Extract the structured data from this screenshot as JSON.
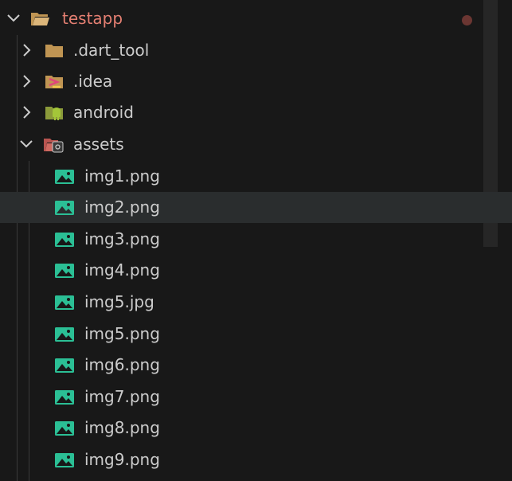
{
  "explorer": {
    "root": {
      "label": "testapp",
      "icon": "folder-open-icon",
      "expanded": true,
      "modified_dot_color": "#6b3632"
    },
    "folders": [
      {
        "label": ".dart_tool",
        "icon": "folder-icon",
        "expanded": false
      },
      {
        "label": ".idea",
        "icon": "idea-folder-icon",
        "expanded": false
      },
      {
        "label": "android",
        "icon": "android-folder-icon",
        "expanded": false
      },
      {
        "label": "assets",
        "icon": "assets-folder-icon",
        "expanded": true
      }
    ],
    "files": [
      {
        "label": "img1.png",
        "icon": "image-icon"
      },
      {
        "label": "img2.png",
        "icon": "image-icon",
        "selected": true
      },
      {
        "label": "img3.png",
        "icon": "image-icon"
      },
      {
        "label": "img4.png",
        "icon": "image-icon"
      },
      {
        "label": "img5.jpg",
        "icon": "image-icon"
      },
      {
        "label": "img5.png",
        "icon": "image-icon"
      },
      {
        "label": "img6.png",
        "icon": "image-icon"
      },
      {
        "label": "img7.png",
        "icon": "image-icon"
      },
      {
        "label": "img8.png",
        "icon": "image-icon"
      },
      {
        "label": "img9.png",
        "icon": "image-icon"
      }
    ],
    "colors": {
      "background": "#181818",
      "selected_row": "#2a2d2e",
      "root_label": "#e47f72",
      "text": "#cccccc",
      "image_icon": "#2bbf95",
      "folder": "#c09553"
    }
  }
}
